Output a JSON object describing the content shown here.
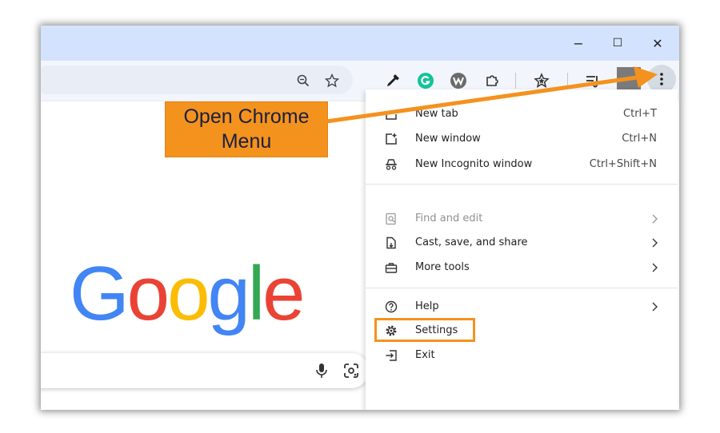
{
  "window_controls": {
    "minimize": "−",
    "maximize": "☐",
    "close": "✕"
  },
  "toolbar_icons": [
    "zoom-icon",
    "bookmark-star-icon",
    "eyedropper-extension-icon",
    "grammarly-extension-icon",
    "wordtune-extension-icon",
    "extensions-puzzle-icon",
    "bookmarks-icon",
    "reading-list-icon",
    "profile-avatar",
    "kebab-menu-icon"
  ],
  "google_logo": {
    "letters": [
      "G",
      "o",
      "o",
      "g",
      "l",
      "e"
    ],
    "colors": [
      "#4285f4",
      "#ea4335",
      "#fbbc05",
      "#4285f4",
      "#34a853",
      "#ea4335"
    ]
  },
  "menu": {
    "items": [
      {
        "label": "New tab",
        "shortcut": "Ctrl+T",
        "icon": "new-tab-icon"
      },
      {
        "label": "New window",
        "shortcut": "Ctrl+N",
        "icon": "new-window-icon"
      },
      {
        "label": "New Incognito window",
        "shortcut": "Ctrl+Shift+N",
        "icon": "incognito-icon"
      },
      {
        "label": "Find and edit",
        "icon": "find-icon",
        "submenu": true,
        "disabled_look": true
      },
      {
        "label": "Cast, save, and share",
        "icon": "cast-save-icon",
        "submenu": true
      },
      {
        "label": "More tools",
        "icon": "toolbox-icon",
        "submenu": true
      },
      {
        "label": "Help",
        "icon": "help-icon",
        "submenu": true
      },
      {
        "label": "Settings",
        "icon": "gear-icon"
      },
      {
        "label": "Exit",
        "icon": "exit-icon"
      }
    ]
  },
  "annotation": {
    "callout_text": "Open Chrome\nMenu",
    "accent_color": "#f4921e",
    "text_color": "#1a2040"
  }
}
